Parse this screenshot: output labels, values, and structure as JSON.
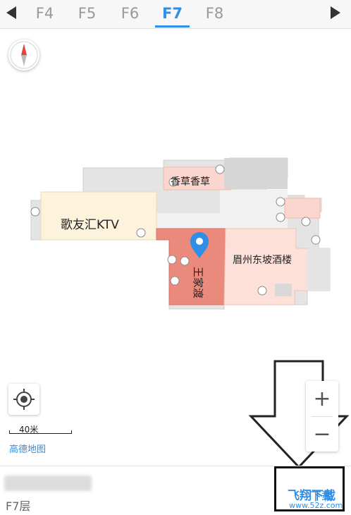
{
  "floor_selector": {
    "tabs": [
      "F4",
      "F5",
      "F6",
      "F7",
      "F8"
    ],
    "active_tab": "F7"
  },
  "map": {
    "stores": {
      "ktv": "歌友汇KTV",
      "xiangcao": "香草香草",
      "wangjia": "王家渡",
      "meizhou": "眉州东坡酒楼"
    },
    "scale_label": "40米",
    "brand": "高德地图",
    "colors": {
      "accent": "#2f8ee6",
      "ktv_fill": "#fdf3dc",
      "xiangcao_fill": "#fbd6cf",
      "wangjia_fill": "#e98a7d",
      "meizhou_fill": "#fde0d8",
      "building_gray": "#dcdcdc"
    }
  },
  "bottom_panel": {
    "floor_text": "F7层",
    "download_label": "下载"
  },
  "watermark": {
    "text": "飞翔下载",
    "url": "www.52z.com"
  }
}
